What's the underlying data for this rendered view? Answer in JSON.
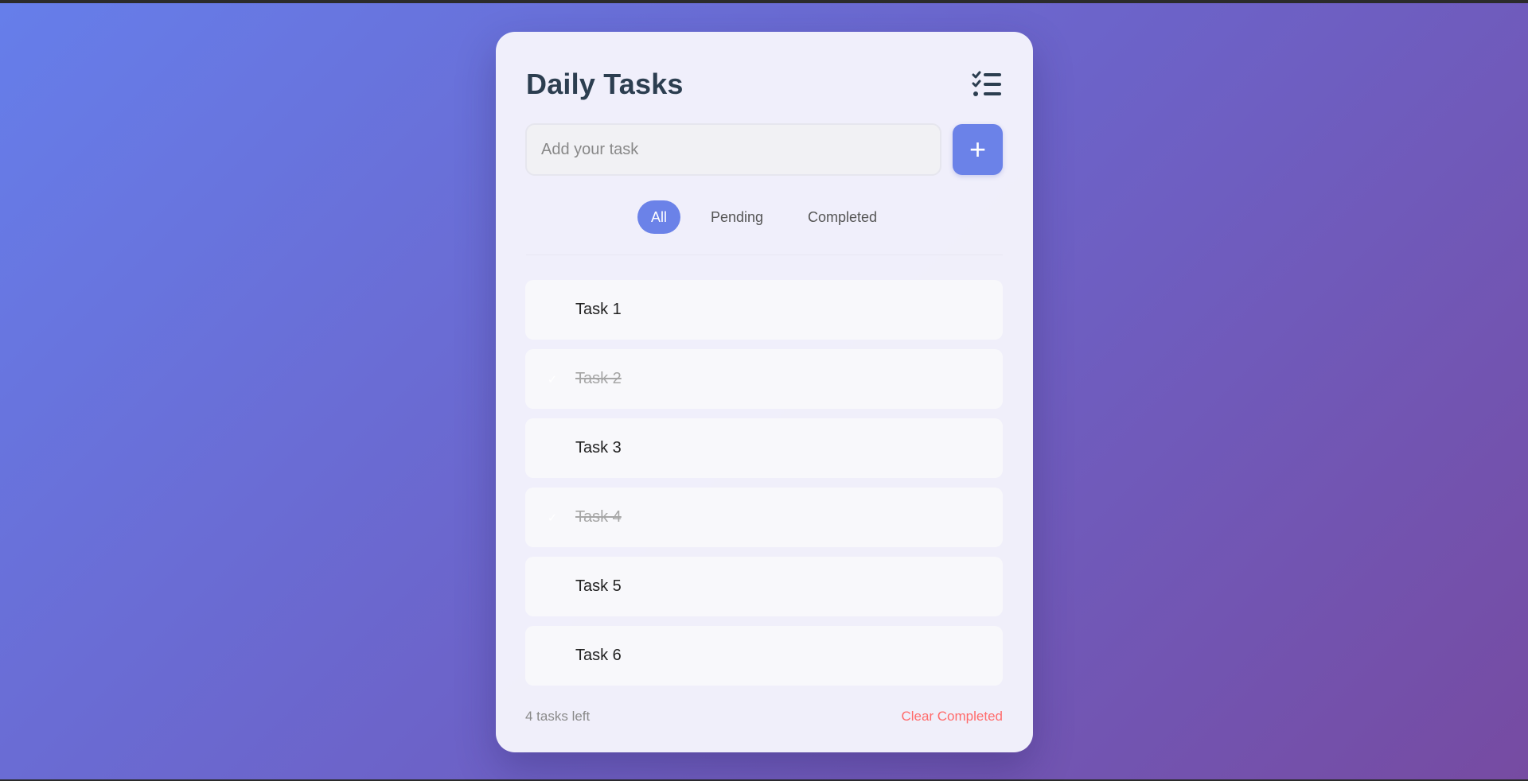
{
  "app": {
    "title": "Daily Tasks",
    "header_icon": "checklist-icon"
  },
  "input": {
    "placeholder": "Add your task",
    "value": "",
    "add_button_label": "+",
    "add_button_icon": "plus-icon"
  },
  "filters": [
    {
      "label": "All",
      "active": true
    },
    {
      "label": "Pending",
      "active": false
    },
    {
      "label": "Completed",
      "active": false
    }
  ],
  "tasks": [
    {
      "text": "Task 1",
      "completed": false
    },
    {
      "text": "Task 2",
      "completed": true,
      "check_mark": "✓"
    },
    {
      "text": "Task 3",
      "completed": false
    },
    {
      "text": "Task 4",
      "completed": true,
      "check_mark": "✓"
    },
    {
      "text": "Task 5",
      "completed": false
    },
    {
      "text": "Task 6",
      "completed": false
    }
  ],
  "footer": {
    "tasks_left": "4 tasks left",
    "clear_label": "Clear Completed"
  },
  "colors": {
    "accent": "#6b82e8",
    "title": "#2c3e50",
    "danger": "#ff6b6b",
    "background_start": "#667eea",
    "background_end": "#764ba2"
  }
}
